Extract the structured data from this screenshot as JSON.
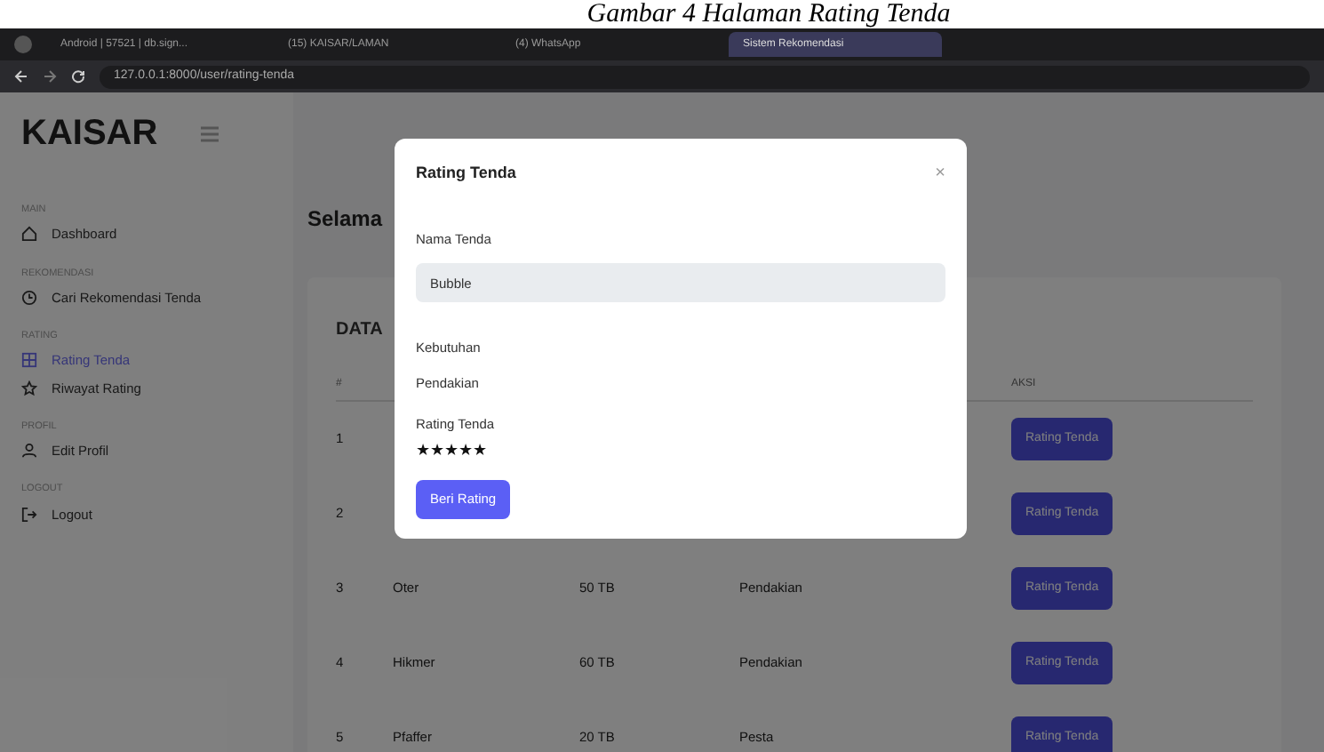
{
  "caption": "Gambar 4 Halaman Rating Tenda",
  "browser": {
    "tabs": [
      {
        "label": "Android | 57521 | db.sign...",
        "selected": false
      },
      {
        "label": "(15) KAISAR/LAMAN",
        "selected": false
      },
      {
        "label": "(4) WhatsApp",
        "selected": false
      },
      {
        "label": "Sistem Rekomendasi",
        "selected": true
      }
    ],
    "url": "127.0.0.1:8000/user/rating-tenda"
  },
  "sidebar": {
    "brand": "KAISAR",
    "sections": [
      {
        "heading": "MAIN",
        "items": [
          {
            "label": "Dashboard",
            "selected": false,
            "kind": "home"
          }
        ]
      },
      {
        "heading": "REKOMENDASI",
        "items": [
          {
            "label": "Cari Rekomendasi Tenda",
            "selected": false,
            "kind": "clock"
          }
        ]
      },
      {
        "heading": "RATING",
        "items": [
          {
            "label": "Rating Tenda",
            "selected": true,
            "kind": "grid"
          },
          {
            "label": "Riwayat Rating",
            "selected": false,
            "kind": "star"
          }
        ]
      },
      {
        "heading": "PROFIL",
        "items": [
          {
            "label": "Edit Profil",
            "selected": false,
            "kind": "user"
          }
        ]
      },
      {
        "heading": "LOGOUT",
        "items": [
          {
            "label": "Logout",
            "selected": false,
            "kind": "logout"
          }
        ]
      }
    ]
  },
  "main": {
    "greeting": "Selama",
    "card_title": "DATA",
    "table": {
      "columns": [
        "#",
        "AKSI"
      ],
      "rows": [
        {
          "no": "1",
          "cells": [],
          "action": "Rating Tenda"
        },
        {
          "no": "2",
          "cells": [],
          "action": "Rating Tenda"
        },
        {
          "no": "3",
          "cells": [
            "Oter",
            "50 TB",
            "Pendakian"
          ],
          "action": "Rating Tenda"
        },
        {
          "no": "4",
          "cells": [
            "Hikmer",
            "60 TB",
            "Pendakian"
          ],
          "action": "Rating Tenda"
        },
        {
          "no": "5",
          "cells": [
            "Pfaffer",
            "20 TB",
            "Pesta"
          ],
          "action": "Rating Tenda"
        }
      ]
    }
  },
  "modal": {
    "title": "Rating Tenda",
    "close": "×",
    "name_label": "Nama Tenda",
    "name_value": "Bubble",
    "need_label": "Kebutuhan",
    "need_value": "Pendakian",
    "rating_label": "Rating Tenda",
    "stars": 5,
    "submit": "Beri Rating"
  }
}
